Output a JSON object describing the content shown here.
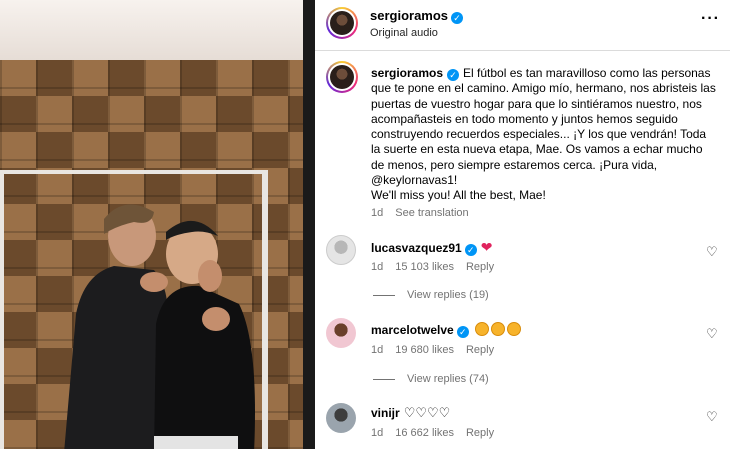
{
  "post": {
    "username": "sergioramos",
    "audio": "Original audio",
    "more_label": "···"
  },
  "caption": {
    "username": "sergioramos",
    "text": "El fútbol es tan maravilloso como las personas que te pone en el camino. Amigo mío, hermano, nos abristeis las puertas de vuestro hogar para que lo sintiéramos nuestro, nos acompañasteis en todo momento y juntos hemos seguido construyendo recuerdos especiales... ¡Y los que vendrán! Toda la suerte en esta nueva etapa, Mae. Os vamos a echar mucho de menos, pero siempre estaremos cerca. ¡Pura vida,",
    "mention": "@keylornavas1!",
    "english": "We'll miss you! All the best, Mae!",
    "time": "1d",
    "translate": "See translation"
  },
  "comments": [
    {
      "username": "lucasvazquez91",
      "text_icons": [
        "red-heart"
      ],
      "time": "1d",
      "likes": "15 103 likes",
      "reply": "Reply",
      "view_replies": "View replies (19)"
    },
    {
      "username": "marcelotwelve",
      "text_icons": [
        "heart-eyes",
        "heart-eyes",
        "heart-eyes"
      ],
      "time": "1d",
      "likes": "19 680 likes",
      "reply": "Reply",
      "view_replies": "View replies (74)"
    },
    {
      "username": "vinijr",
      "text": "♡♡♡♡",
      "time": "1d",
      "likes": "16 662 likes",
      "reply": "Reply"
    }
  ],
  "icons": {
    "verified": "✓",
    "like": "♡"
  },
  "colors": {
    "verified": "#0095f6",
    "heart": "#e0245e",
    "meta": "#737373"
  }
}
